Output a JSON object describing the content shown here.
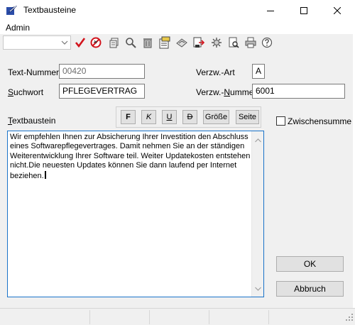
{
  "window": {
    "title": "Textbausteine"
  },
  "menu": {
    "admin": "Admin"
  },
  "toolbar": {
    "combo_value": "",
    "icons": [
      "check-icon",
      "delete-icon",
      "copy-icon",
      "search-icon",
      "trash-icon",
      "import-icon",
      "attach-icon",
      "export-icon",
      "settings-icon",
      "preview-icon",
      "print-icon",
      "help-icon"
    ]
  },
  "form": {
    "text_nummer_label": "Text-Nummer",
    "text_nummer_value": "00420",
    "suchwort_label": "Suchwort",
    "suchwort_value": "PFLEGEVERTRAG",
    "verzw_art_label": "Verzw.-Art",
    "verzw_art_value": "A",
    "verzw_nummer_label": "Verzw.-Nummer",
    "verzw_nummer_value": "6001",
    "textbaustein_label": "Textbaustein"
  },
  "format": {
    "bold": "F",
    "italic": "K",
    "underline": "U",
    "strike": "D",
    "size": "Größe",
    "page": "Seite"
  },
  "zwischensumme_label": "Zwischensumme",
  "textbaustein_text": "Wir empfehlen Ihnen zur Absicherung Ihrer Investition den Abschluss\neines Softwarepflegevertrages. Damit nehmen Sie an der ständigen\nWeiterentwicklung Ihrer Software teil. Weiter Updatekosten entstehen\nnicht.Die neuesten Updates können Sie dann laufend per Internet\nbeziehen.",
  "buttons": {
    "ok": "OK",
    "abbruch": "Abbruch"
  }
}
